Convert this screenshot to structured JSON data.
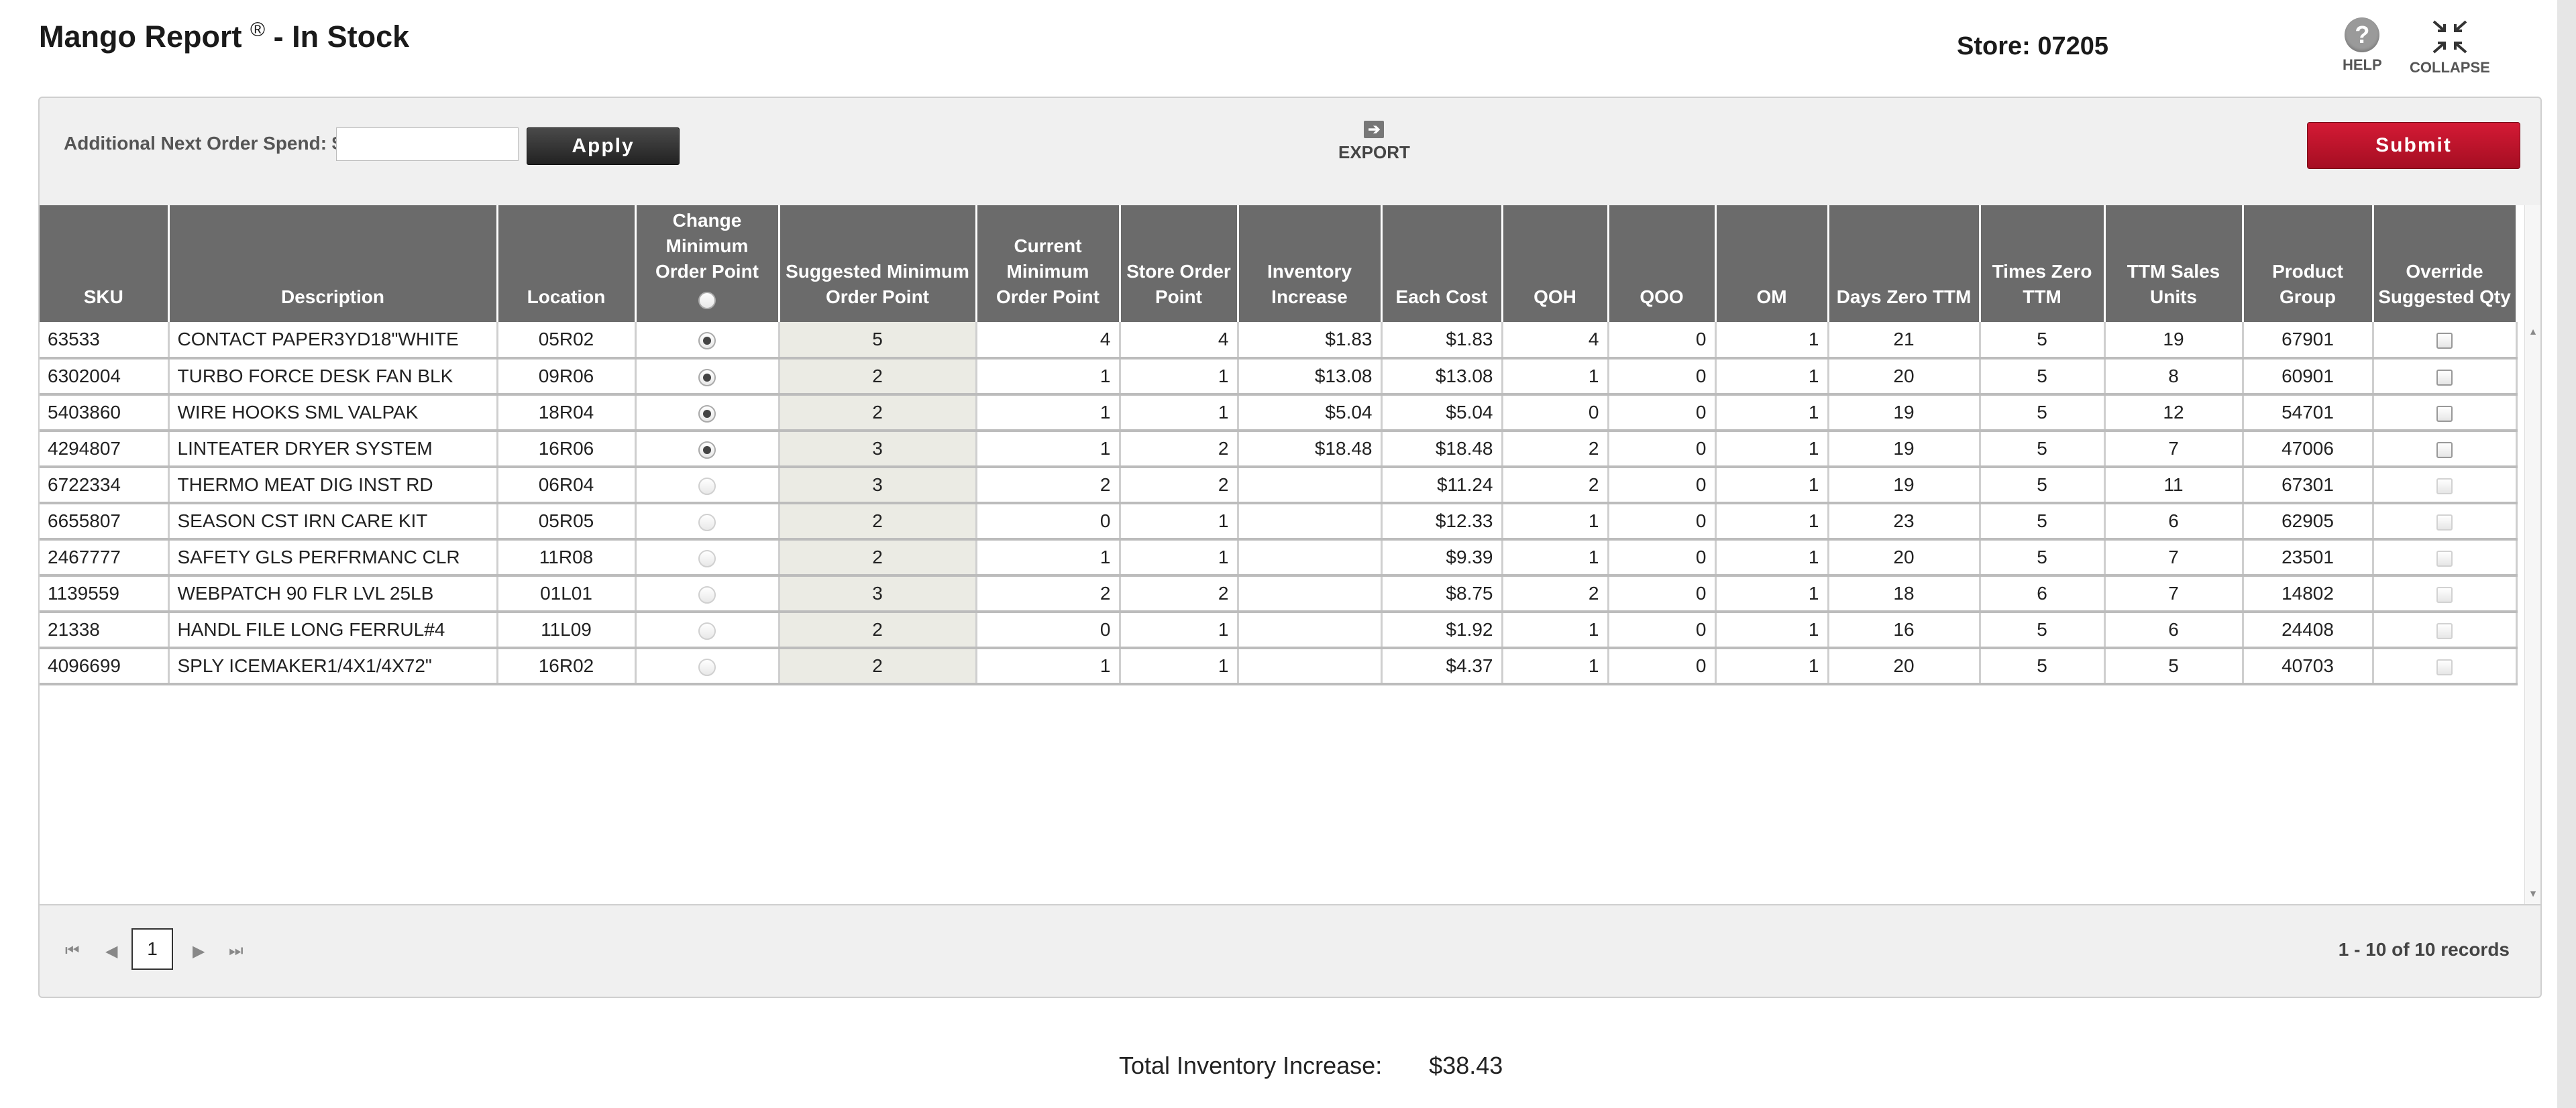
{
  "header": {
    "title": "Mango Report",
    "registered": "®",
    "subtitle": " - In Stock",
    "store": "Store: 07205",
    "help_label": "HELP",
    "collapse_label": "COLLAPSE"
  },
  "toolbar": {
    "spend_label": "Additional Next Order Spend: $",
    "spend_value": "",
    "apply_label": "Apply",
    "export_label": "EXPORT",
    "submit_label": "Submit"
  },
  "columns": [
    "SKU",
    "Description",
    "Location",
    "Change Minimum Order Point",
    "Suggested Minimum Order Point",
    "Current Minimum Order Point",
    "Store Order Point",
    "Inventory Increase",
    "Each Cost",
    "QOH",
    "QOO",
    "OM",
    "Days Zero TTM",
    "Times Zero TTM",
    "TTM Sales Units",
    "Product Group",
    "Override Suggested Qty"
  ],
  "rows": [
    {
      "sku": "63533",
      "desc": "CONTACT PAPER3YD18\"WHITE",
      "loc": "05R02",
      "change": "on",
      "sugg": "5",
      "cur": "4",
      "sop": "4",
      "inc": "$1.83",
      "cost": "$1.83",
      "qoh": "4",
      "qoo": "0",
      "om": "1",
      "dz": "21",
      "tz": "5",
      "ttm": "19",
      "pg": "67901",
      "override": "enabled"
    },
    {
      "sku": "6302004",
      "desc": "TURBO FORCE DESK FAN BLK",
      "loc": "09R06",
      "change": "on",
      "sugg": "2",
      "cur": "1",
      "sop": "1",
      "inc": "$13.08",
      "cost": "$13.08",
      "qoh": "1",
      "qoo": "0",
      "om": "1",
      "dz": "20",
      "tz": "5",
      "ttm": "8",
      "pg": "60901",
      "override": "enabled"
    },
    {
      "sku": "5403860",
      "desc": "WIRE HOOKS SML VALPAK",
      "loc": "18R04",
      "change": "on",
      "sugg": "2",
      "cur": "1",
      "sop": "1",
      "inc": "$5.04",
      "cost": "$5.04",
      "qoh": "0",
      "qoo": "0",
      "om": "1",
      "dz": "19",
      "tz": "5",
      "ttm": "12",
      "pg": "54701",
      "override": "enabled"
    },
    {
      "sku": "4294807",
      "desc": "LINTEATER DRYER SYSTEM",
      "loc": "16R06",
      "change": "on",
      "sugg": "3",
      "cur": "1",
      "sop": "2",
      "inc": "$18.48",
      "cost": "$18.48",
      "qoh": "2",
      "qoo": "0",
      "om": "1",
      "dz": "19",
      "tz": "5",
      "ttm": "7",
      "pg": "47006",
      "override": "enabled"
    },
    {
      "sku": "6722334",
      "desc": "THERMO MEAT DIG INST RD",
      "loc": "06R04",
      "change": "off",
      "sugg": "3",
      "cur": "2",
      "sop": "2",
      "inc": "",
      "cost": "$11.24",
      "qoh": "2",
      "qoo": "0",
      "om": "1",
      "dz": "19",
      "tz": "5",
      "ttm": "11",
      "pg": "67301",
      "override": "disabled"
    },
    {
      "sku": "6655807",
      "desc": "SEASON CST IRN CARE KIT",
      "loc": "05R05",
      "change": "off",
      "sugg": "2",
      "cur": "0",
      "sop": "1",
      "inc": "",
      "cost": "$12.33",
      "qoh": "1",
      "qoo": "0",
      "om": "1",
      "dz": "23",
      "tz": "5",
      "ttm": "6",
      "pg": "62905",
      "override": "disabled"
    },
    {
      "sku": "2467777",
      "desc": "SAFETY GLS PERFRMANC CLR",
      "loc": "11R08",
      "change": "off",
      "sugg": "2",
      "cur": "1",
      "sop": "1",
      "inc": "",
      "cost": "$9.39",
      "qoh": "1",
      "qoo": "0",
      "om": "1",
      "dz": "20",
      "tz": "5",
      "ttm": "7",
      "pg": "23501",
      "override": "disabled"
    },
    {
      "sku": "1139559",
      "desc": "WEBPATCH 90 FLR LVL 25LB",
      "loc": "01L01",
      "change": "off",
      "sugg": "3",
      "cur": "2",
      "sop": "2",
      "inc": "",
      "cost": "$8.75",
      "qoh": "2",
      "qoo": "0",
      "om": "1",
      "dz": "18",
      "tz": "6",
      "ttm": "7",
      "pg": "14802",
      "override": "disabled"
    },
    {
      "sku": "21338",
      "desc": "HANDL FILE LONG FERRUL#4",
      "loc": "11L09",
      "change": "off",
      "sugg": "2",
      "cur": "0",
      "sop": "1",
      "inc": "",
      "cost": "$1.92",
      "qoh": "1",
      "qoo": "0",
      "om": "1",
      "dz": "16",
      "tz": "5",
      "ttm": "6",
      "pg": "24408",
      "override": "disabled"
    },
    {
      "sku": "4096699",
      "desc": "SPLY ICEMAKER1/4X1/4X72\"",
      "loc": "16R02",
      "change": "off",
      "sugg": "2",
      "cur": "1",
      "sop": "1",
      "inc": "",
      "cost": "$4.37",
      "qoh": "1",
      "qoo": "0",
      "om": "1",
      "dz": "20",
      "tz": "5",
      "ttm": "5",
      "pg": "40703",
      "override": "disabled"
    }
  ],
  "pager": {
    "current_page": "1",
    "records": "1 - 10 of 10 records"
  },
  "footer": {
    "total_label": "Total Inventory Increase:",
    "total_value": "$38.43"
  },
  "colors": {
    "header_bg": "#6b6b6b",
    "submit": "#c0132b",
    "apply": "#333333"
  }
}
